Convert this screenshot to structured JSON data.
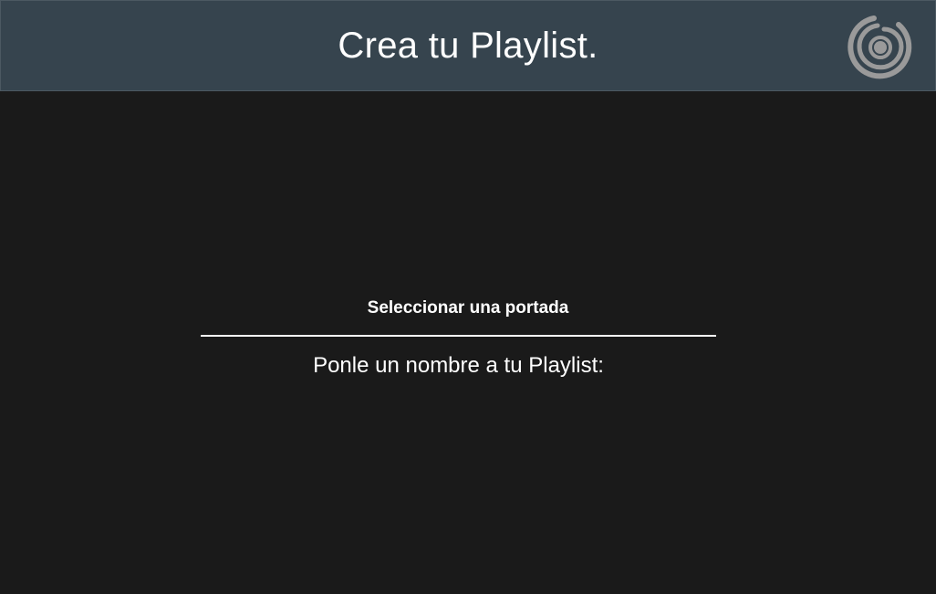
{
  "header": {
    "title": "Crea tu Playlist.",
    "logo_icon": "vinyl-record-logo-icon",
    "background_color": "#36444e"
  },
  "main": {
    "cover_button_label": "Seleccionar una portada",
    "name_label": "Ponle un nombre a tu Playlist:",
    "background_color": "#1a1a1a"
  }
}
